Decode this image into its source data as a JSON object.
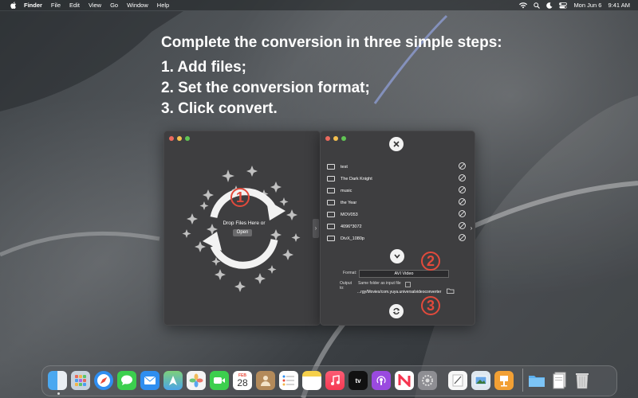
{
  "menubar": {
    "app_name": "Finder",
    "items": [
      "File",
      "Edit",
      "View",
      "Go",
      "Window",
      "Help"
    ],
    "date": "Mon Jun 6",
    "time": "9:41 AM"
  },
  "headline": "Complete the conversion in three simple steps:",
  "steps": [
    "1. Add files;",
    "2. Set the conversion format;",
    "3. Click convert."
  ],
  "left_window": {
    "drop_label": "Drop Files Here or",
    "open_label": "Open"
  },
  "right_window": {
    "files": [
      "test",
      "The Dark Knight",
      "music",
      "the Year",
      "MOV053",
      "4096*3072",
      "DivX_1080p"
    ],
    "format_label": "Format:",
    "format_value": "AVI Video",
    "output_label": "Output to:",
    "same_folder_label": "Same folder as input file",
    "output_path": "...rgy/Movies/com.yuya.universalvideoconverter"
  },
  "badges": [
    "1",
    "2",
    "3"
  ],
  "dock": {
    "calendar_month": "FEB",
    "calendar_day": "28",
    "apps": [
      "finder-icon",
      "launchpad-icon",
      "safari-icon",
      "messages-icon",
      "mail-icon",
      "maps-icon",
      "photos-icon",
      "facetime-icon",
      "calendar-icon",
      "contacts-icon",
      "reminders-icon",
      "notes-icon",
      "music-icon",
      "apple-tv-icon",
      "podcasts-icon",
      "news-icon",
      "system-preferences-icon",
      "textedit-icon",
      "preview-icon",
      "keynote-icon",
      "folder-icon",
      "documents-icon",
      "trash-icon"
    ]
  },
  "colors": {
    "accent_red": "#e24a3c",
    "window_bg": "#3e3e40"
  }
}
